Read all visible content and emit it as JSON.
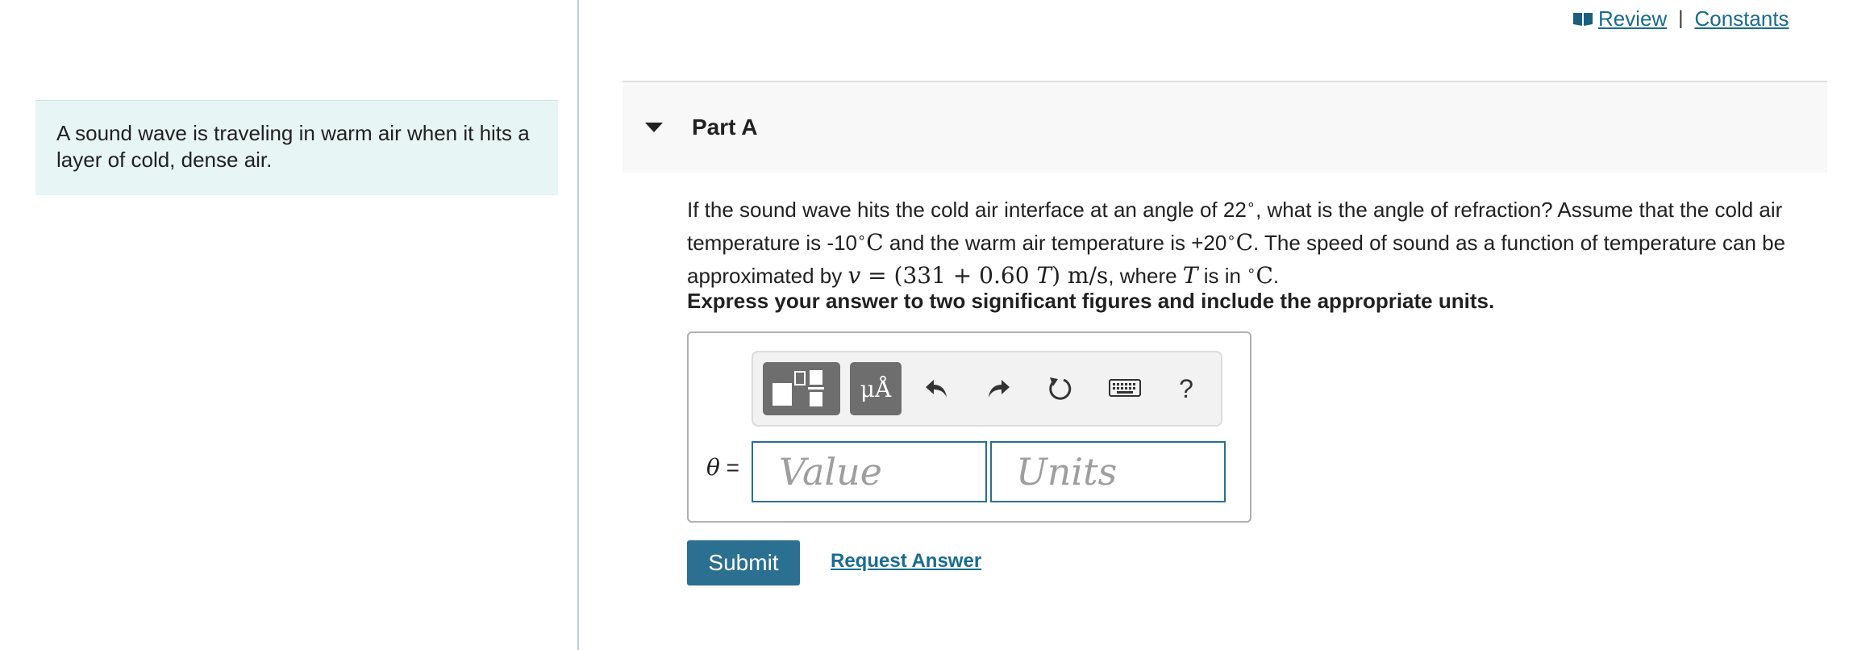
{
  "intro": {
    "text": "A sound wave is traveling in warm air when it hits a layer of cold, dense air."
  },
  "top_links": {
    "review": "Review",
    "separator": "|",
    "constants": "Constants",
    "book_icon": "book-icon"
  },
  "part": {
    "title": "Part A"
  },
  "question": {
    "s1": "If the sound wave hits the cold air interface at an angle of 22",
    "deg1": "∘",
    "s2": ", what is the angle of refraction? Assume that the cold air temperature is -10",
    "deg2": "∘",
    "unit_c1": "C",
    "s3": " and the warm air temperature is +20",
    "deg3": "∘",
    "unit_c2": "C",
    "s4": ". The speed of sound as a function of temperature can be approximated by ",
    "v": "v",
    "eq": " = (331 + 0.60 ",
    "T1": "T",
    "eq_close": ") m/s",
    "s5": ", where ",
    "T2": "T",
    "s6": " is in ",
    "deg4": "∘",
    "unit_c3": "C",
    "s7": "."
  },
  "instruction": "Express your answer to two significant figures and include the appropriate units.",
  "toolbar": {
    "templates_icon": "templates-icon",
    "units_label": "μÅ",
    "undo_icon": "undo-icon",
    "redo_icon": "redo-icon",
    "reset_icon": "reset-icon",
    "keyboard_icon": "keyboard-icon",
    "help_label": "?"
  },
  "answer": {
    "variable": "θ",
    "equals": " =",
    "value_placeholder": "Value",
    "units_placeholder": "Units"
  },
  "actions": {
    "submit": "Submit",
    "request_answer": "Request Answer"
  },
  "colors": {
    "accent": "#2b6f91",
    "link": "#1a6c8f",
    "intro_bg": "#e8f5f5"
  }
}
